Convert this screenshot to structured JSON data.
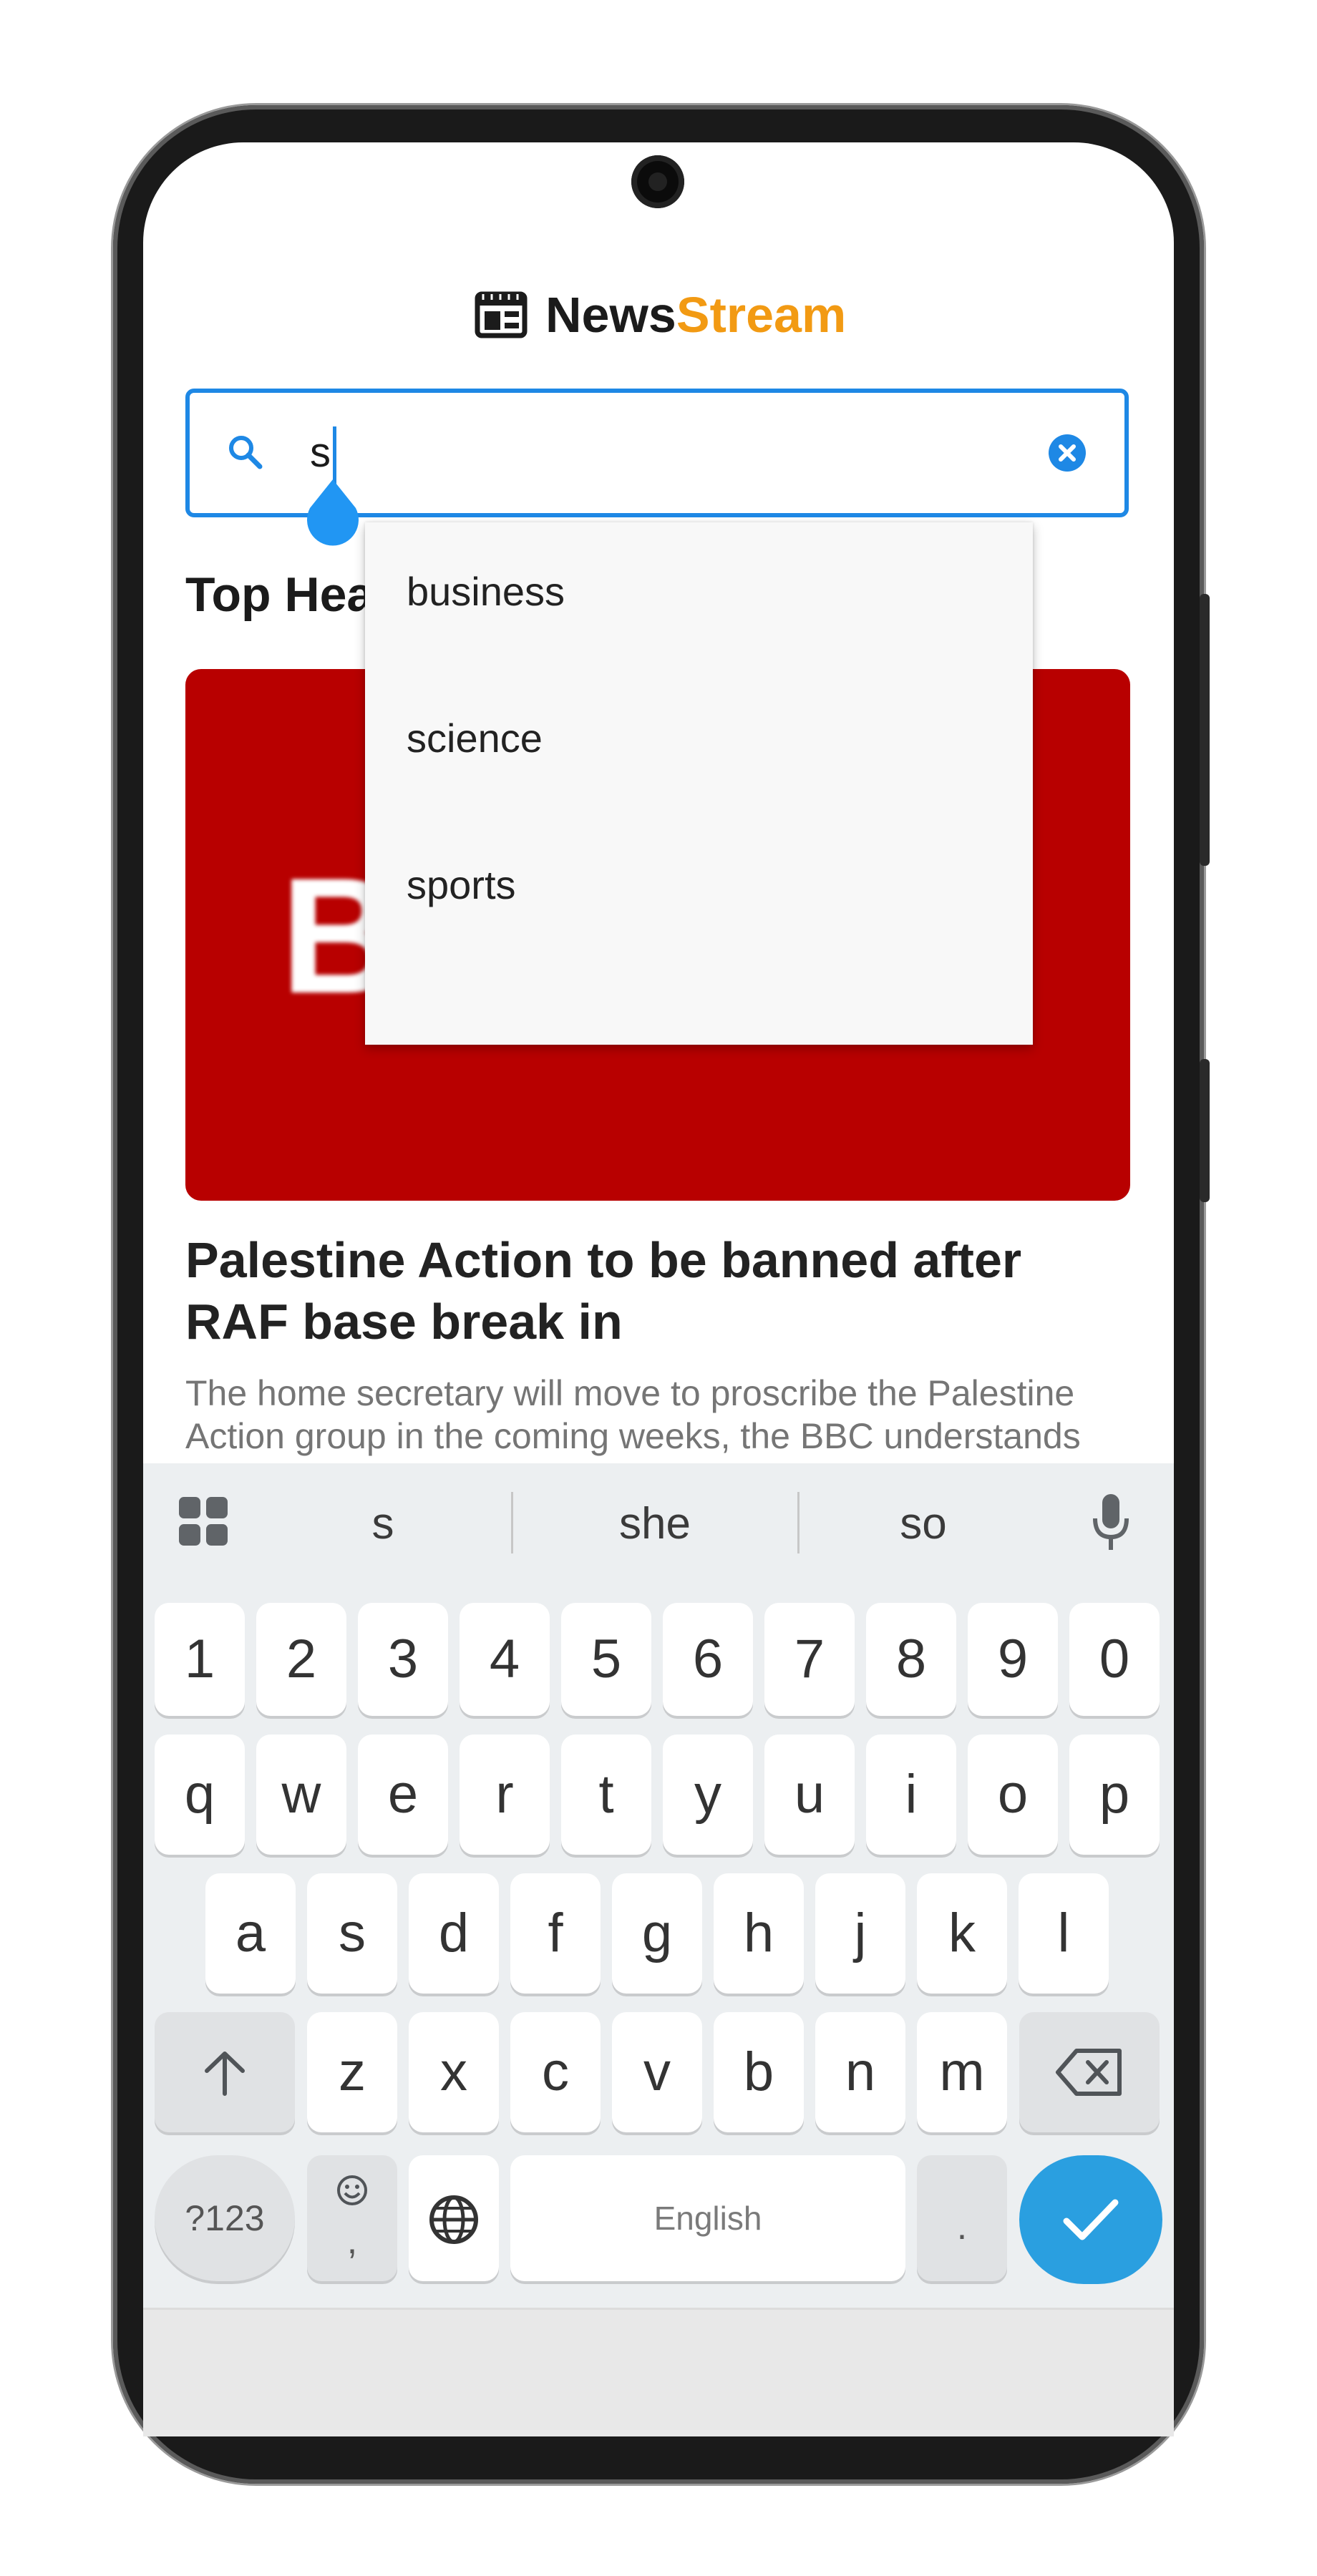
{
  "app": {
    "brand_part1": "News",
    "brand_part2": "Stream",
    "brand_color": "#f29a13",
    "accent_color": "#1e88e5"
  },
  "search": {
    "value": "s",
    "icon": "search-icon",
    "clear_icon": "clear-icon"
  },
  "section": {
    "title": "Top Headlines"
  },
  "dropdown": {
    "items": [
      "business",
      "science",
      "sports"
    ]
  },
  "article": {
    "hero_logo_text": "B",
    "headline": "Palestine Action to be banned after RAF base break in",
    "summary": "The home secretary will move to proscribe the Palestine Action group in the coming weeks, the BBC understands"
  },
  "keyboard": {
    "suggestions": [
      "s",
      "she",
      "so"
    ],
    "number_row": [
      "1",
      "2",
      "3",
      "4",
      "5",
      "6",
      "7",
      "8",
      "9",
      "0"
    ],
    "row1": [
      "q",
      "w",
      "e",
      "r",
      "t",
      "y",
      "u",
      "i",
      "o",
      "p"
    ],
    "row2": [
      "a",
      "s",
      "d",
      "f",
      "g",
      "h",
      "j",
      "k",
      "l"
    ],
    "row3": [
      "z",
      "x",
      "c",
      "v",
      "b",
      "n",
      "m"
    ],
    "symbols_label": "?123",
    "comma_label": ",",
    "space_label": "English",
    "period_label": ".",
    "enter_color": "#2a9fe0"
  }
}
